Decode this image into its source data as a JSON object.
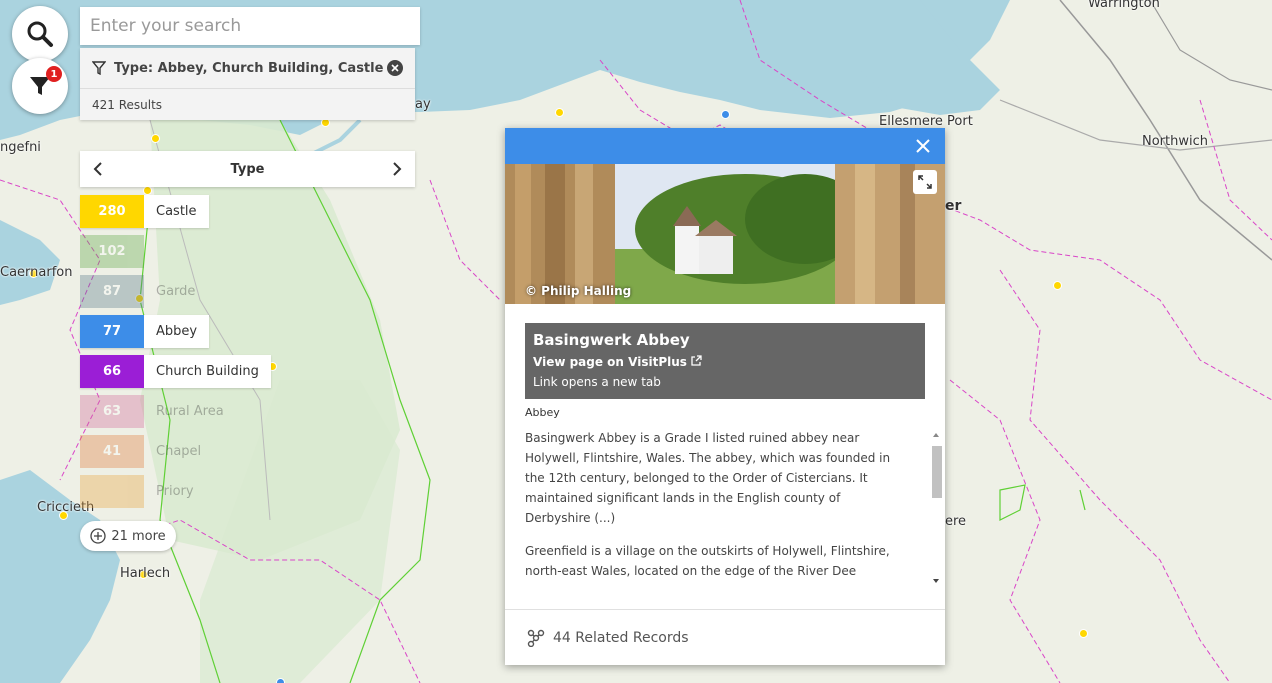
{
  "search": {
    "placeholder": "Enter your search"
  },
  "filters": {
    "badge": "1",
    "type_filter": "Type: Abbey, Church Building, Castle",
    "results": "421 Results"
  },
  "type_panel": {
    "title": "Type",
    "items": [
      {
        "count": "280",
        "label": "Castle",
        "color": "#ffd700",
        "active": true
      },
      {
        "count": "102",
        "label": "",
        "color": "#5fa845",
        "active": false
      },
      {
        "count": "87",
        "label": "Garde",
        "color": "#5a7a8a",
        "active": false
      },
      {
        "count": "77",
        "label": "Abbey",
        "color": "#3d8de8",
        "active": true
      },
      {
        "count": "66",
        "label": "Church Building",
        "color": "#9b1ed6",
        "active": true
      },
      {
        "count": "63",
        "label": "Rural Area",
        "color": "#d26a9a",
        "active": false
      },
      {
        "count": "41",
        "label": "Chapel",
        "color": "#e07a3a",
        "active": false
      },
      {
        "count": "",
        "label": "Priory",
        "color": "#e8a23a",
        "active": false
      }
    ],
    "more": "21 more"
  },
  "map": {
    "places": [
      "Warrington",
      "Ellesmere Port",
      "Northwich",
      "ngefni",
      "Caernarfon",
      "Criccieth",
      "Harlech",
      "ay",
      "er",
      "ere"
    ]
  },
  "popup": {
    "photo_credit": "© Philip Halling",
    "name": "Basingwerk Abbey",
    "link": "View page on VisitPlus",
    "link_note": "Link opens a new tab",
    "category": "Abbey",
    "paragraphs": [
      "Basingwerk Abbey is a Grade I listed ruined abbey near Holywell, Flintshire, Wales. The abbey, which was founded in the 12th century, belonged to the Order of Cistercians. It maintained significant lands in the English county of Derbyshire (...)",
      "Greenfield is a village on the outskirts of Holywell, Flintshire, north-east Wales, located on the edge of the River Dee"
    ],
    "related": "44 Related Records"
  },
  "colors": {
    "accent": "#3d8de8",
    "sea": "#aad3df",
    "land": "#eef0e6",
    "boundary": "#d946c8"
  }
}
